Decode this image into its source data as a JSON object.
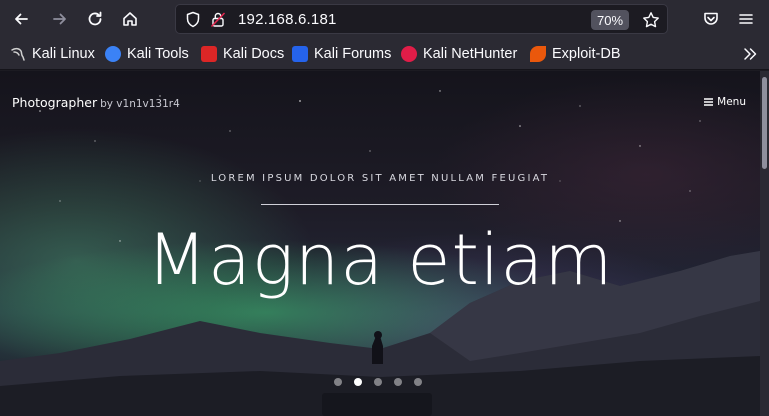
{
  "browser": {
    "url": "192.168.6.181",
    "zoom": "70%",
    "icons": [
      "back-arrow-icon",
      "forward-arrow-icon",
      "reload-icon",
      "home-icon",
      "shield-icon",
      "lock-icon",
      "star-icon",
      "pocket-icon",
      "hamburger-icon"
    ]
  },
  "bookmarks": [
    {
      "label": "Kali Linux",
      "icon": "kali-dragon-icon",
      "color": "#d0d0d0"
    },
    {
      "label": "Kali Tools",
      "icon": "kali-tools-icon",
      "color": "#3b82f6"
    },
    {
      "label": "Kali Docs",
      "icon": "kali-docs-icon",
      "color": "#dc2626"
    },
    {
      "label": "Kali Forums",
      "icon": "kali-forums-icon",
      "color": "#2563eb"
    },
    {
      "label": "Kali NetHunter",
      "icon": "nethunter-icon",
      "color": "#e11d48"
    },
    {
      "label": "Exploit-DB",
      "icon": "exploitdb-icon",
      "color": "#ea580c"
    }
  ],
  "site": {
    "brand": "Photographer",
    "brand_by": "by v1n1v131r4",
    "menu": "Menu"
  },
  "hero": {
    "subtitle": "LOREM IPSUM DOLOR SIT AMET NULLAM FEUGIAT",
    "title": "Magna etiam",
    "slide_count": 5,
    "active_slide": 2
  }
}
